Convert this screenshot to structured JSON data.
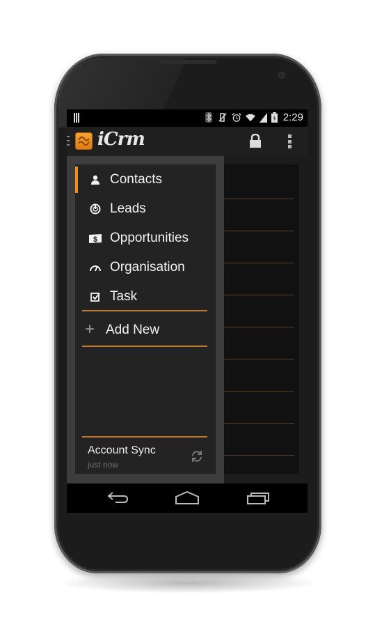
{
  "statusbar": {
    "time": "2:29",
    "icons": [
      "notification-bars-icon",
      "bluetooth-icon",
      "vibrate-off-icon",
      "alarm-icon",
      "wifi-icon",
      "cell-signal-icon",
      "battery-charging-icon"
    ]
  },
  "actionbar": {
    "app_title": "iCrm",
    "logo_icon": "app-logo-icon",
    "lock_icon": "lock-icon",
    "overflow_icon": "overflow-menu-icon"
  },
  "drawer": {
    "items": [
      {
        "label": "Contacts",
        "icon": "person-icon",
        "active": true
      },
      {
        "label": "Leads",
        "icon": "power-icon",
        "active": false
      },
      {
        "label": "Opportunities",
        "icon": "dollar-icon",
        "active": false
      },
      {
        "label": "Organisation",
        "icon": "gauge-icon",
        "active": false
      },
      {
        "label": "Task",
        "icon": "checkbox-icon",
        "active": false
      }
    ],
    "add_new_label": "Add New",
    "sync": {
      "title": "Account Sync",
      "subtitle": "just now"
    }
  },
  "colors": {
    "accent": "#f0901a",
    "divider": "#c27a2a",
    "panel": "#232323",
    "drawer_border": "#3d3d3d"
  },
  "navbar": {
    "buttons": [
      "back",
      "home",
      "recent-apps"
    ]
  }
}
